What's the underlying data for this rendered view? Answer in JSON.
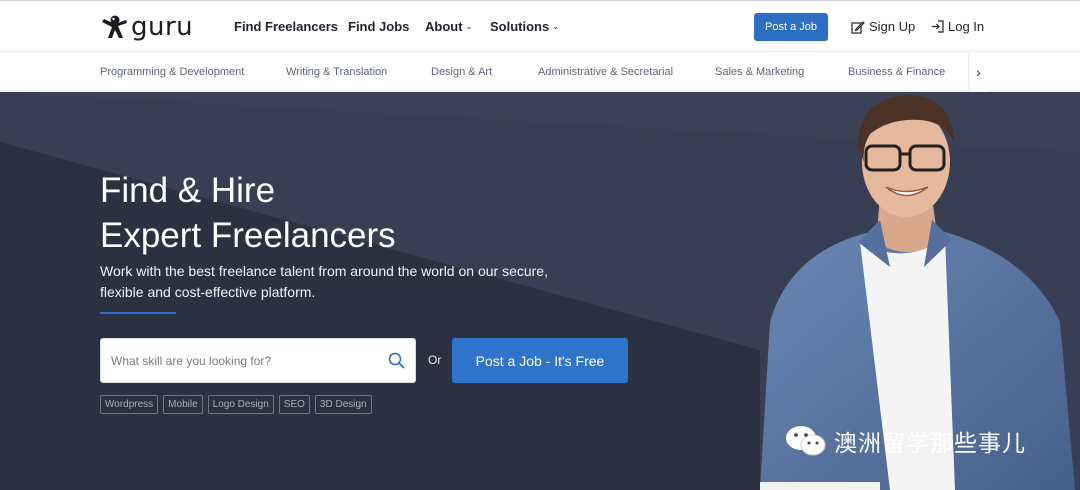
{
  "brand": {
    "name": "guru"
  },
  "nav": {
    "find_freelancers": "Find Freelancers",
    "find_jobs": "Find Jobs",
    "about": "About",
    "solutions": "Solutions",
    "post_job": "Post a Job",
    "sign_up": "Sign Up",
    "log_in": "Log In"
  },
  "categories": [
    "Programming & Development",
    "Writing & Translation",
    "Design & Art",
    "Administrative & Secretarial",
    "Sales & Marketing",
    "Business & Finance"
  ],
  "hero": {
    "title_line1": "Find & Hire",
    "title_line2": "Expert Freelancers",
    "subtitle": "Work with the best freelance talent from around the world on our secure, flexible and cost-effective platform.",
    "search_placeholder": "What skill are you looking for?",
    "or": "Or",
    "post_job_button": "Post a Job - It's Free",
    "tags": [
      "Wordpress",
      "Mobile",
      "Logo Design",
      "SEO",
      "3D Design"
    ]
  },
  "watermark": {
    "text": "澳洲留学那些事儿"
  },
  "colors": {
    "accent": "#2c6fc2",
    "hero_bg": "#393f52",
    "nav_text": "#1f2430"
  }
}
